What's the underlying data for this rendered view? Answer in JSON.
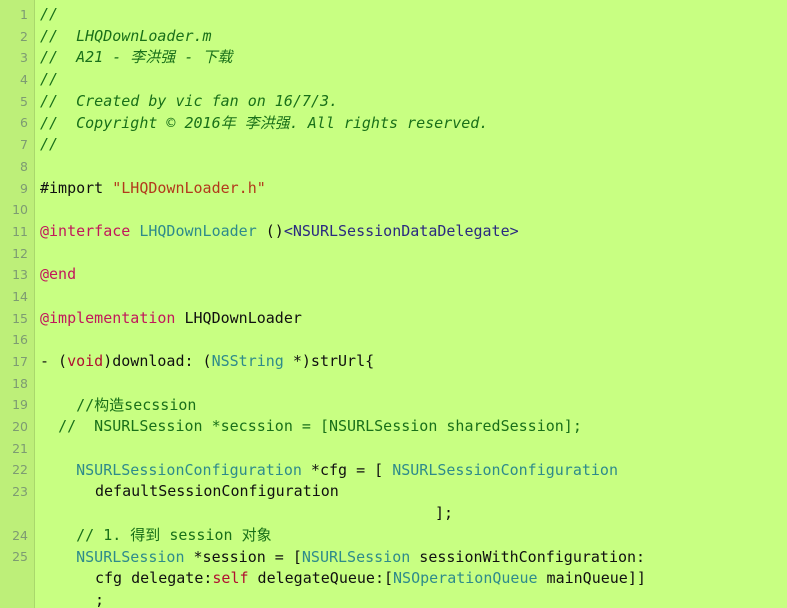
{
  "editor": {
    "language": "Objective-C",
    "colors": {
      "background": "#c8ff82",
      "gutter_background": "#bdef79",
      "gutter_divider": "#a9d86c",
      "line_number": "#7d9b72",
      "comment": "#197019",
      "string": "#b23a1c",
      "keyword": "#c2185b",
      "keyword_alt": "#b01030",
      "type": "#2e8b8b",
      "protocol": "#2a2a80",
      "plain_text": "#101010"
    },
    "line_numbers": [
      "1",
      "2",
      "3",
      "4",
      "5",
      "6",
      "7",
      "8",
      "9",
      "10",
      "11",
      "12",
      "13",
      "14",
      "15",
      "16",
      "17",
      "18",
      "19",
      "20",
      "21",
      "22",
      "23",
      "24",
      "25"
    ],
    "lines": [
      {
        "n": "1",
        "text": "//"
      },
      {
        "n": "2",
        "text": "//  LHQDownLoader.m"
      },
      {
        "n": "3",
        "text": "//  A21 - 李洪强 - 下载"
      },
      {
        "n": "4",
        "text": "//"
      },
      {
        "n": "5",
        "text": "//  Created by vic fan on 16/7/3."
      },
      {
        "n": "6",
        "text": "//  Copyright © 2016年 李洪强. All rights reserved."
      },
      {
        "n": "7",
        "text": "//"
      },
      {
        "n": "8",
        "text": ""
      },
      {
        "n": "9",
        "text": "#import \"LHQDownLoader.h\""
      },
      {
        "n": "10",
        "text": ""
      },
      {
        "n": "11",
        "text": "@interface LHQDownLoader ()<NSURLSessionDataDelegate>"
      },
      {
        "n": "12",
        "text": ""
      },
      {
        "n": "13",
        "text": "@end"
      },
      {
        "n": "14",
        "text": ""
      },
      {
        "n": "15",
        "text": "@implementation LHQDownLoader"
      },
      {
        "n": "16",
        "text": ""
      },
      {
        "n": "17",
        "text": "- (void)download: (NSString *)strUrl{"
      },
      {
        "n": "18",
        "text": ""
      },
      {
        "n": "19",
        "text": "    //构造secssion"
      },
      {
        "n": "20",
        "text": "  //  NSURLSession *secssion = [NSURLSession sharedSession];"
      },
      {
        "n": "21",
        "text": ""
      },
      {
        "n": "22",
        "text": "    NSURLSessionConfiguration *cfg = [ NSURLSessionConfiguration defaultSessionConfiguration                      ];"
      },
      {
        "n": "23",
        "text": ""
      },
      {
        "n": "24",
        "text": "    // 1. 得到 session 对象"
      },
      {
        "n": "25",
        "text": "    NSURLSession *session = [NSURLSession sessionWithConfiguration: cfg delegate:self delegateQueue:[NSOperationQueue mainQueue]] ;"
      }
    ],
    "tokens": {
      "c1": "//",
      "c2": "//  LHQDownLoader.m",
      "c3": "//  A21 - 李洪强 - 下载",
      "c4": "//",
      "c5": "//  Created by vic fan on 16/7/3.",
      "c6": "//  Copyright © 2016年 李洪强. All rights reserved.",
      "c7": "//",
      "import_kw": "#import ",
      "import_str": "\"LHQDownLoader.h\"",
      "interface_kw": "@interface ",
      "interface_name": "LHQDownLoader ",
      "interface_paren": "()",
      "interface_proto": "<NSURLSessionDataDelegate>",
      "end_kw": "@end",
      "impl_kw": "@implementation ",
      "impl_name": "LHQDownLoader",
      "m_dash": "- (",
      "m_void": "void",
      "m_mid": ")download: (",
      "m_nsstring": "NSString",
      "m_tail": " *)strUrl{",
      "c19": "    //构造secssion",
      "c20": "  //  NSURLSession *secssion = [NSURLSession sharedSession];",
      "l22_a": "    ",
      "l22_type": "NSURLSessionConfiguration",
      "l22_b": " *cfg = [ ",
      "l22_type2": "NSURLSessionConfiguration",
      "l22_cont": "defaultSessionConfiguration",
      "l22_close": "];",
      "c24": "    // 1. 得到 session 对象",
      "l25_a": "    ",
      "l25_type": "NSURLSession",
      "l25_b": " *session = [",
      "l25_type2": "NSURLSession",
      "l25_c": " sessionWithConfiguration:",
      "l25_cont_a": "cfg delegate:",
      "l25_self": "self",
      "l25_cont_b": " delegateQueue:[",
      "l25_type3": "NSOperationQueue",
      "l25_cont_c": " mainQueue]]",
      "l25_semi": ";"
    }
  }
}
